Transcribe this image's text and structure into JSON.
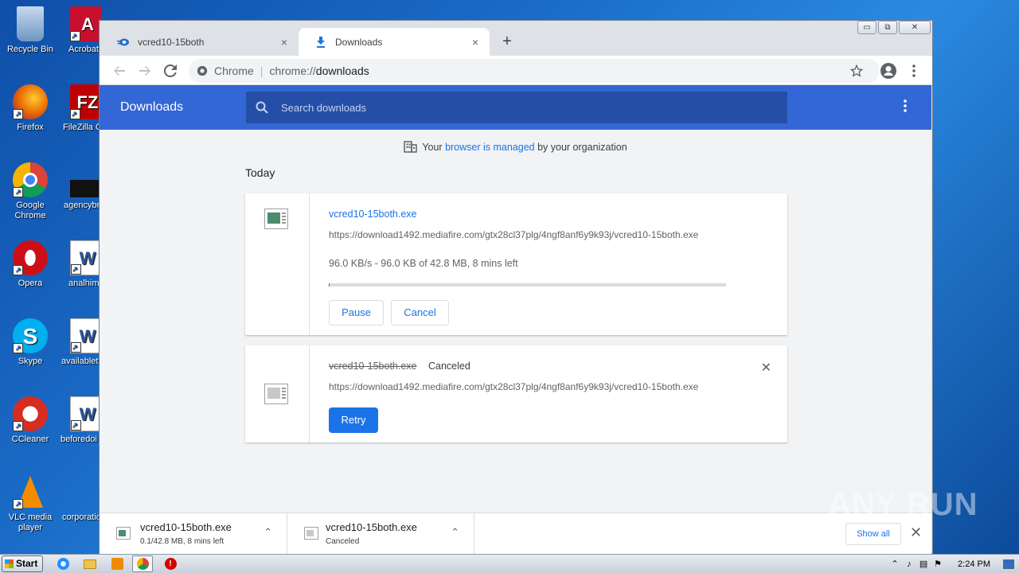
{
  "desktop": {
    "icons": [
      {
        "label": "Recycle Bin",
        "icon": "recycle-bin-icon",
        "color": "#8fb4d9"
      },
      {
        "label": "Firefox",
        "icon": "firefox-icon",
        "color": "#e66000"
      },
      {
        "label": "Google Chrome",
        "icon": "chrome-icon",
        "color": "#4285f4"
      },
      {
        "label": "Opera",
        "icon": "opera-icon",
        "color": "#cc0f16"
      },
      {
        "label": "Skype",
        "icon": "skype-icon",
        "color": "#00aff0"
      },
      {
        "label": "CCleaner",
        "icon": "ccleaner-icon",
        "color": "#d62d20"
      },
      {
        "label": "VLC media player",
        "icon": "vlc-icon",
        "color": "#f48b00"
      },
      {
        "label": "Acrobat Reader",
        "icon": "acrobat-icon",
        "color": "#c8102e"
      },
      {
        "label": "FileZilla C",
        "icon": "filezilla-icon",
        "color": "#bf0000"
      },
      {
        "label": "agencybr",
        "icon": "file-icon",
        "color": "#111111"
      },
      {
        "label": "analhim",
        "icon": "word-doc-icon",
        "color": "#2b579a"
      },
      {
        "label": "availablet",
        "icon": "word-doc-icon",
        "color": "#2b579a"
      },
      {
        "label": "beforedoi",
        "icon": "word-doc-icon",
        "color": "#2b579a"
      },
      {
        "label": "corporatio",
        "icon": "word-doc-icon",
        "color": "#2b579a"
      }
    ]
  },
  "browser": {
    "tabs": [
      {
        "title": "vcred10-15both",
        "close": "×"
      },
      {
        "title": "Downloads",
        "close": "×"
      }
    ],
    "new_tab": "+",
    "window_controls": {
      "minimize": "▭",
      "restore": "⧉",
      "close": "✕"
    },
    "omnibox": {
      "site": "Chrome",
      "url_scheme": "chrome://",
      "url_host": "downloads"
    }
  },
  "downloads_page": {
    "title": "Downloads",
    "search_placeholder": "Search downloads",
    "managed": {
      "prefix": "Your ",
      "link": "browser is managed",
      "suffix": " by your organization"
    },
    "section": "Today",
    "items": [
      {
        "filename": "vcred10-15both.exe",
        "url": "https://download1492.mediafire.com/gtx28cl37plg/4ngf8anf6y9k93j/vcred10-15both.exe",
        "progress_text": "96.0 KB/s - 96.0 KB of 42.8 MB, 8 mins left",
        "progress_fraction": 0.002,
        "pause_label": "Pause",
        "cancel_label": "Cancel"
      },
      {
        "filename": "vcred10-15both.exe",
        "status": "Canceled",
        "url": "https://download1492.mediafire.com/gtx28cl37plg/4ngf8anf6y9k93j/vcred10-15both.exe",
        "retry_label": "Retry",
        "remove": "✕"
      }
    ]
  },
  "shelf": {
    "items": [
      {
        "name": "vcred10-15both.exe",
        "status": "0.1/42.8 MB, 8 mins left",
        "chevron": "⌃"
      },
      {
        "name": "vcred10-15both.exe",
        "status": "Canceled",
        "chevron": "⌃"
      }
    ],
    "show_all": "Show all",
    "close": "✕"
  },
  "watermark": "ANY RUN",
  "taskbar": {
    "start_label": "Start",
    "apps": [
      {
        "icon": "ie-icon",
        "color": "#1e90ff"
      },
      {
        "icon": "explorer-folder-icon",
        "color": "#f2c24d"
      },
      {
        "icon": "media-player-icon",
        "color": "#f08a00"
      },
      {
        "icon": "chrome-icon",
        "color": "#4285f4"
      },
      {
        "icon": "stop-icon",
        "color": "#d40000"
      }
    ],
    "clock": "2:24 PM"
  },
  "colors": {
    "accent": "#1a73e8",
    "header_blue": "#3367d6"
  }
}
